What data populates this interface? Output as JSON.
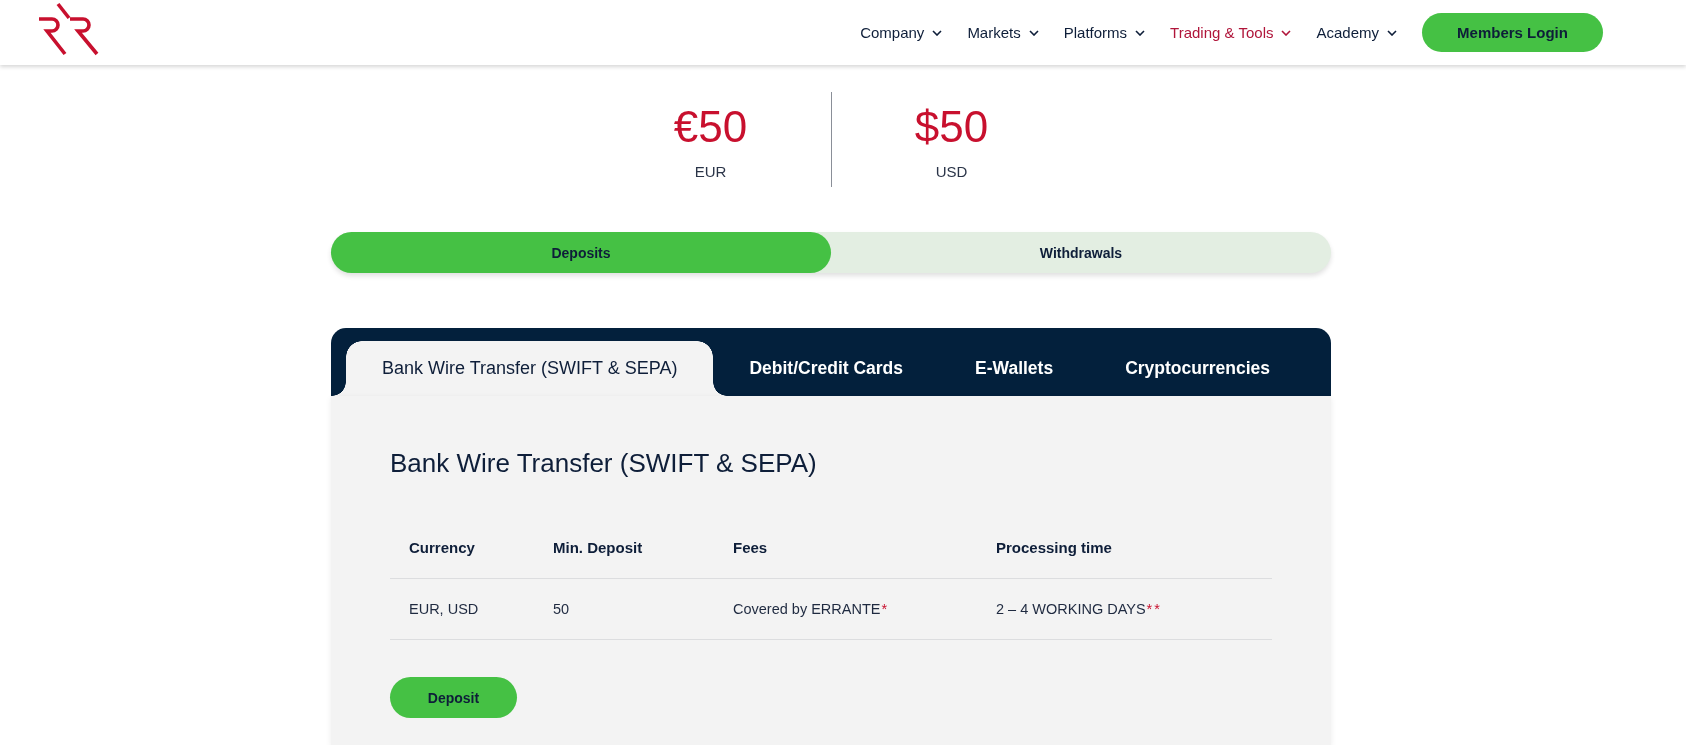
{
  "nav": {
    "items": [
      {
        "label": "Company",
        "selected": false
      },
      {
        "label": "Markets",
        "selected": false
      },
      {
        "label": "Platforms",
        "selected": false
      },
      {
        "label": "Trading & Tools",
        "selected": true
      },
      {
        "label": "Academy",
        "selected": false
      }
    ],
    "login_button": "Members Login"
  },
  "minimums": [
    {
      "amount": "€50",
      "currency": "EUR"
    },
    {
      "amount": "$50",
      "currency": "USD"
    }
  ],
  "mode_toggle": [
    {
      "label": "Deposits",
      "selected": true
    },
    {
      "label": "Withdrawals",
      "selected": false
    }
  ],
  "method_tabs": [
    {
      "label": "Bank Wire Transfer (SWIFT & SEPA)",
      "selected": true
    },
    {
      "label": "Debit/Credit Cards",
      "selected": false
    },
    {
      "label": "E-Wallets",
      "selected": false
    },
    {
      "label": "Cryptocurrencies",
      "selected": false
    }
  ],
  "panel": {
    "title": "Bank Wire Transfer (SWIFT & SEPA)",
    "table": {
      "columns": [
        "Currency",
        "Min. Deposit",
        "Fees",
        "Processing time"
      ],
      "rows": [
        [
          {
            "text": "EUR, USD"
          },
          {
            "text": "50"
          },
          {
            "text": "Covered by ERRANTE",
            "note": "*"
          },
          {
            "text": "2 – 4 WORKING DAYS",
            "note": "**"
          }
        ]
      ]
    },
    "button": "Deposit"
  }
}
